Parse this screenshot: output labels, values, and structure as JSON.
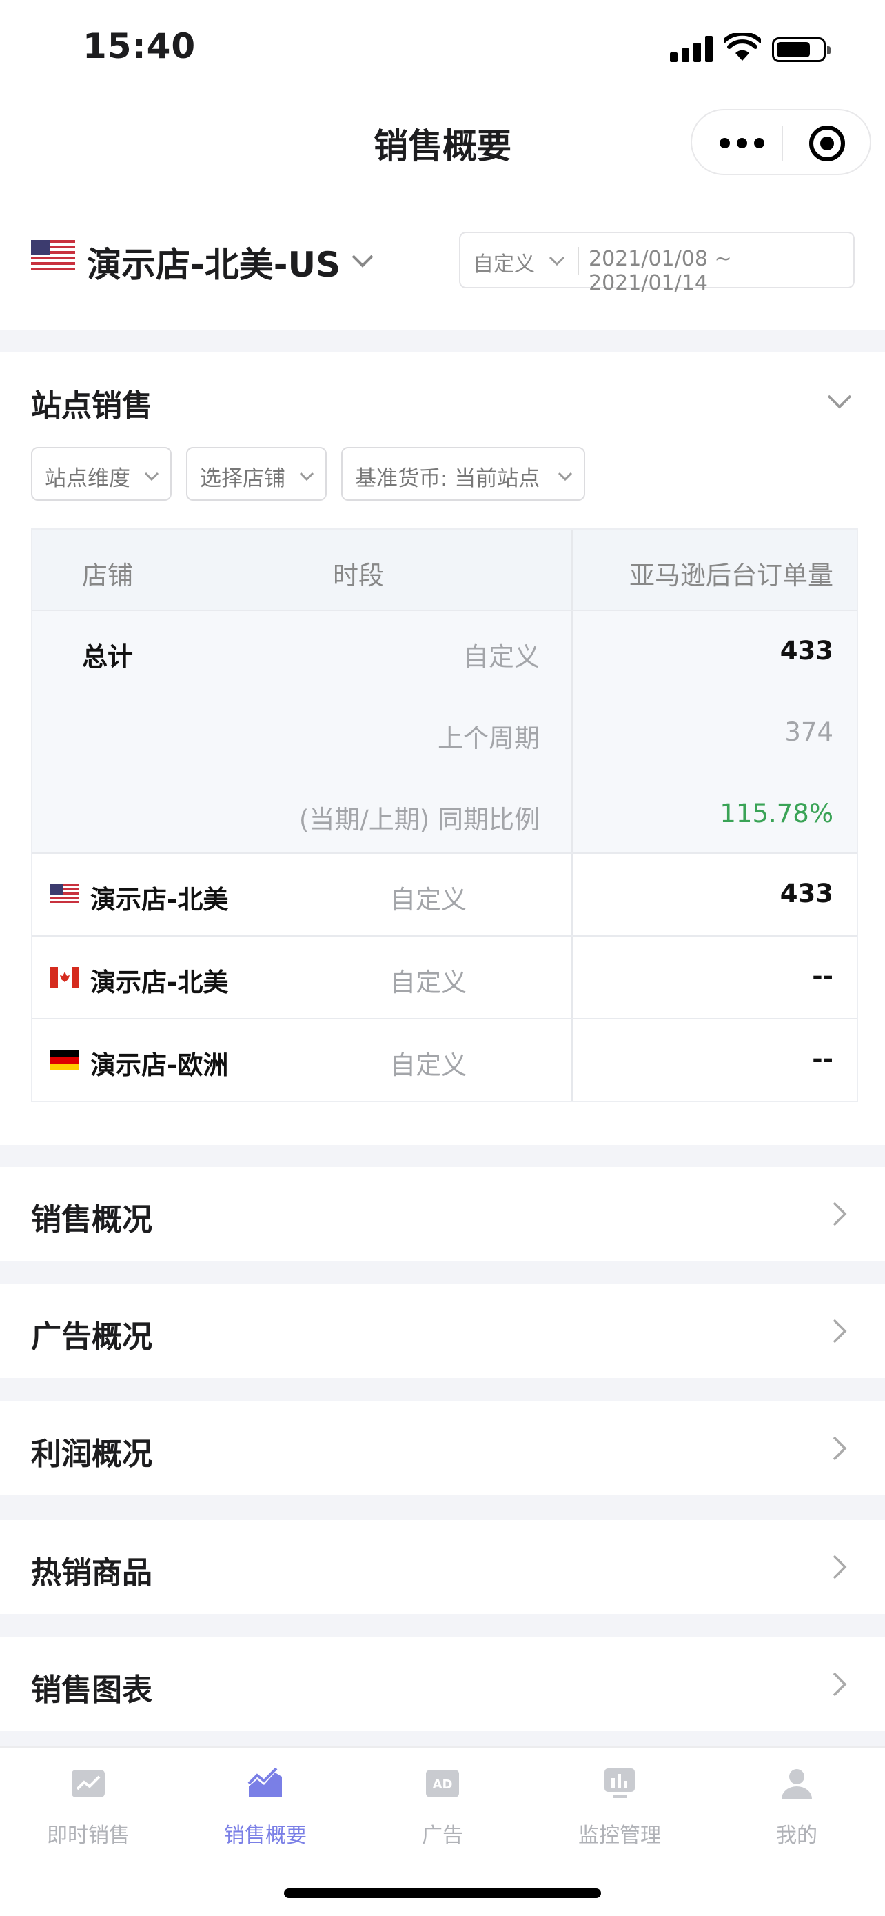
{
  "status_bar": {
    "time": "15:40"
  },
  "nav": {
    "title": "销售概要"
  },
  "store": {
    "name": "演示店-北美-US"
  },
  "date_filter": {
    "mode": "自定义",
    "range": "2021/01/08 ~ 2021/01/14"
  },
  "site_sales": {
    "title": "站点销售",
    "filters": [
      "站点维度",
      "选择店铺",
      "基准货币: 当前站点"
    ],
    "table": {
      "headers": [
        "店铺",
        "时段",
        "亚马逊后台订单量"
      ],
      "total": {
        "label": "总计",
        "rows": [
          {
            "period": "自定义",
            "value": "433"
          },
          {
            "period": "上个周期",
            "value": "374"
          },
          {
            "period": "(当期/上期) 同期比例",
            "value": "115.78%"
          }
        ]
      },
      "rows": [
        {
          "flag": "us-flag",
          "store": "演示店-北美",
          "period": "自定义",
          "value": "433"
        },
        {
          "flag": "ca-flag",
          "store": "演示店-北美",
          "period": "自定义",
          "value": "--"
        },
        {
          "flag": "de-flag",
          "store": "演示店-欧洲",
          "period": "自定义",
          "value": "--"
        }
      ]
    }
  },
  "sections": [
    "销售概况",
    "广告概况",
    "利润概况",
    "热销商品",
    "销售图表"
  ],
  "tabbar": {
    "items": [
      "即时销售",
      "销售概要",
      "广告",
      "监控管理",
      "我的"
    ],
    "active": "销售概要"
  },
  "colors": {
    "accent": "#7a7fe6",
    "green": "#3aa356",
    "gap": "#f3f4f8"
  }
}
